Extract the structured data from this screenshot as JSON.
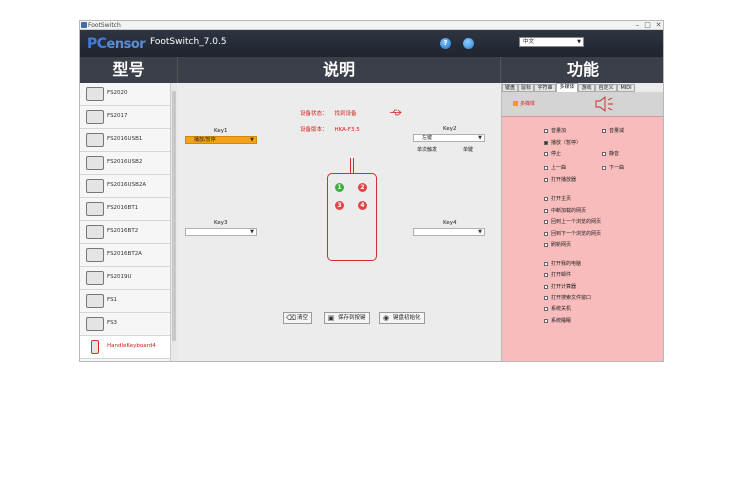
{
  "window": {
    "title": "FootSwitch"
  },
  "header": {
    "logo_text": "PCsensor",
    "logo_pc": "PC",
    "logo_rest": "ensor",
    "app_title": "FootSwitch_7.0.5",
    "language": "中文"
  },
  "columns": {
    "model": "型号",
    "description": "说明",
    "function": "功能"
  },
  "models": [
    {
      "label": "FS2020"
    },
    {
      "label": "FS2017"
    },
    {
      "label": "FS2016USB1"
    },
    {
      "label": "FS2016USB2"
    },
    {
      "label": "FS2016USB2A"
    },
    {
      "label": "FS2016BT1"
    },
    {
      "label": "FS2016BT2"
    },
    {
      "label": "FS2016BT2A"
    },
    {
      "label": "FS2019U"
    },
    {
      "label": "FS1"
    },
    {
      "label": "FS3"
    },
    {
      "label": "HandleKeyboard4"
    }
  ],
  "status": {
    "device_label": "设备状态：",
    "device_value": "找到设备",
    "version_label": "设备版本：",
    "version_value": "HKA-F3.5"
  },
  "keys": {
    "key1": {
      "label": "Key1",
      "value": "播放/暂停"
    },
    "key2": {
      "label": "Key2",
      "value": "左键",
      "sub1": "单次触发",
      "sub2": "单键"
    },
    "key3": {
      "label": "Key3",
      "value": ""
    },
    "key4": {
      "label": "Key4",
      "value": ""
    }
  },
  "device_keys": [
    "1",
    "2",
    "3",
    "4"
  ],
  "buttons": {
    "clear": "清空",
    "save": "保存到按键",
    "init": "键盘初始化"
  },
  "tabs": [
    "键盘",
    "鼠标",
    "字符串",
    "多媒体",
    "游戏",
    "自定义",
    "MIDI"
  ],
  "multimedia": {
    "label": "多媒体"
  },
  "options": [
    {
      "label": "音量加",
      "checked": false
    },
    {
      "label": "音量减",
      "checked": false
    },
    {
      "label": "播放（暂停）",
      "checked": true
    },
    {
      "label": "停止",
      "checked": false
    },
    {
      "label": "静音",
      "checked": false
    },
    {
      "label": "上一曲",
      "checked": false
    },
    {
      "label": "下一曲",
      "checked": false
    },
    {
      "label": "打开播放器",
      "checked": false
    },
    {
      "label": "打开主页",
      "checked": false
    },
    {
      "label": "中断加载的网页",
      "checked": false
    },
    {
      "label": "回到上一个浏览的网页",
      "checked": false
    },
    {
      "label": "回到下一个浏览的网页",
      "checked": false
    },
    {
      "label": "刷新网页",
      "checked": false
    },
    {
      "label": "打开我的电脑",
      "checked": false
    },
    {
      "label": "打开邮件",
      "checked": false
    },
    {
      "label": "打开计算器",
      "checked": false
    },
    {
      "label": "打开搜索文件窗口",
      "checked": false
    },
    {
      "label": "系统关机",
      "checked": false
    },
    {
      "label": "系统睡眠",
      "checked": false
    }
  ],
  "colors": {
    "accent_orange": "#f4a21c",
    "status_red": "#d42020",
    "panel_pink": "#f8bcbc",
    "header_dark": "#2e3542"
  }
}
